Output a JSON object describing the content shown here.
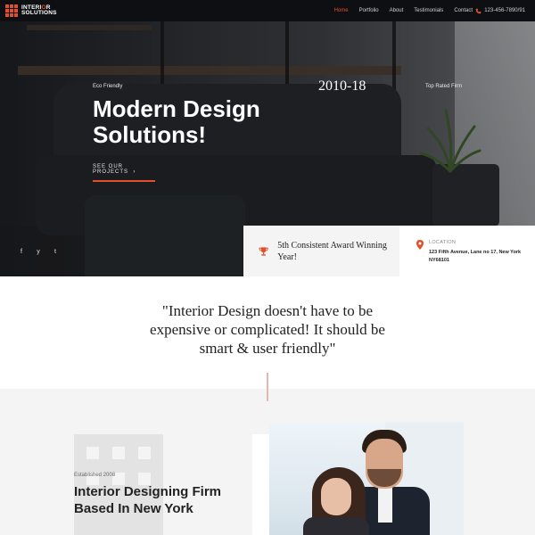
{
  "nav": {
    "logo_line1": "INTERI",
    "logo_o": "O",
    "logo_line1_end": "R",
    "logo_line2": "SOLUTIONS",
    "items": [
      "Home",
      "Portfolio",
      "About",
      "Testimonials",
      "Contact"
    ],
    "active": "Home",
    "phone": "123-456-7890/91",
    "brand_color": "#e0502b"
  },
  "hero": {
    "eyebrow": "Eco Friendly",
    "years": "2010-18",
    "top_rated": "Top Rated Firm",
    "title": "Modern Design Solutions!",
    "cta": "SEE OUR PROJECTS",
    "cta_arrow": "›",
    "social": [
      "f",
      "y",
      "t"
    ]
  },
  "award": {
    "text": "5th Consistent Award Winning Year!",
    "icon": "trophy-icon"
  },
  "location": {
    "label": "LOCATION",
    "address": "123 Fifth Avenue, Lane no 17, New York NY68101",
    "icon": "map-pin-icon"
  },
  "quote": {
    "text": "\"Interior Design doesn't have to be expensive or complicated! It should be smart & user friendly\""
  },
  "about": {
    "established": "Established 2008",
    "title": "Interior Designing Firm Based In New York"
  }
}
